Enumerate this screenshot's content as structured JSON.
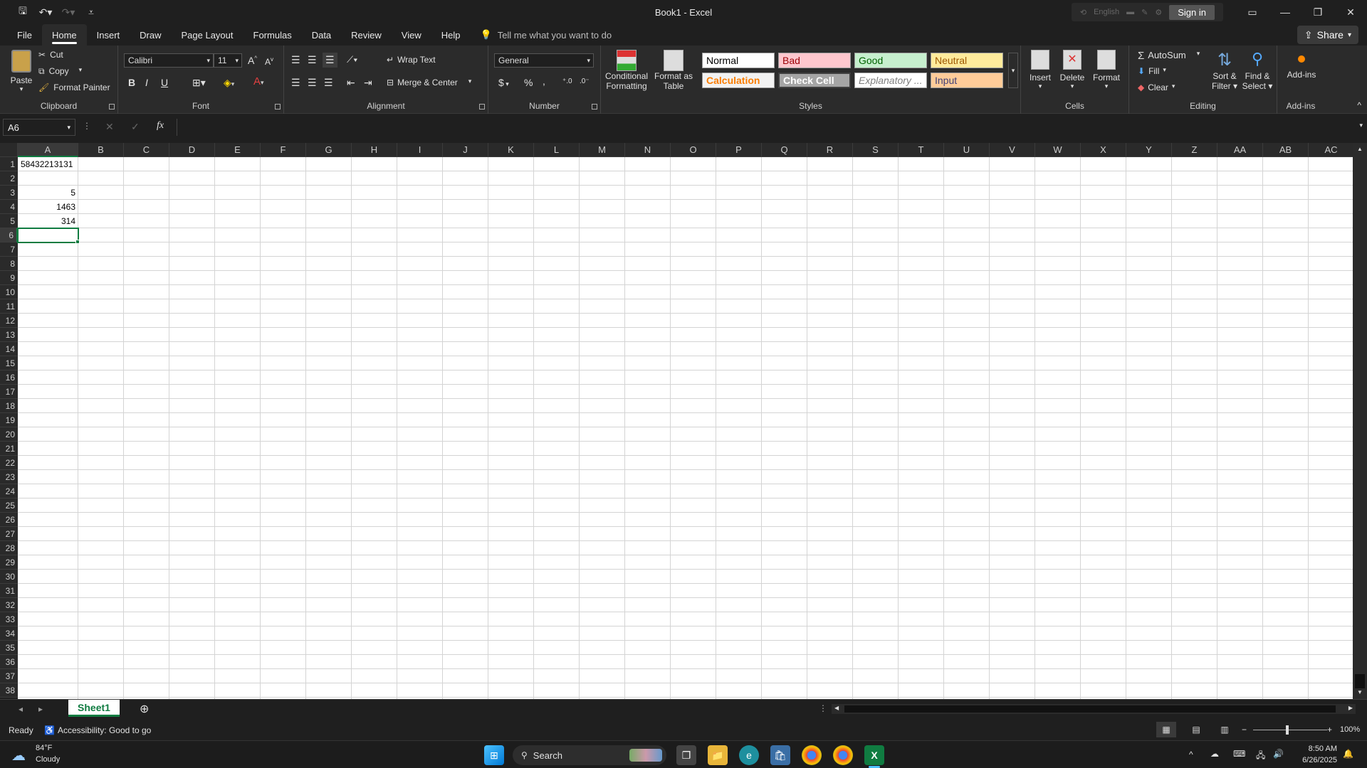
{
  "window": {
    "title": "Book1  -  Excel",
    "language": "English",
    "sign_in": "Sign in"
  },
  "menu": {
    "tabs": [
      "File",
      "Home",
      "Insert",
      "Draw",
      "Page Layout",
      "Formulas",
      "Data",
      "Review",
      "View",
      "Help"
    ],
    "tell_me": "Tell me what you want to do",
    "share": "Share"
  },
  "ribbon": {
    "clipboard": {
      "label": "Clipboard",
      "paste": "Paste",
      "cut": "Cut",
      "copy": "Copy",
      "format_painter": "Format Painter"
    },
    "font": {
      "label": "Font",
      "name": "Calibri",
      "size": "11",
      "bold": "B",
      "italic": "I",
      "underline": "U"
    },
    "alignment": {
      "label": "Alignment",
      "wrap": "Wrap Text",
      "merge": "Merge & Center"
    },
    "number": {
      "label": "Number",
      "format": "General",
      "currency": "$",
      "percent": "%",
      "comma": ","
    },
    "styles": {
      "label": "Styles",
      "conditional": "Conditional",
      "conditional2": "Formatting",
      "format_table": "Format as",
      "format_table2": "Table",
      "normal": "Normal",
      "bad": "Bad",
      "good": "Good",
      "neutral": "Neutral",
      "calculation": "Calculation",
      "check_cell": "Check Cell",
      "explanatory": "Explanatory ...",
      "input": "Input"
    },
    "cells": {
      "label": "Cells",
      "insert": "Insert",
      "delete": "Delete",
      "format": "Format"
    },
    "editing": {
      "label": "Editing",
      "autosum": "AutoSum",
      "fill": "Fill",
      "clear": "Clear",
      "sort": "Sort &",
      "sort2": "Filter",
      "find": "Find &",
      "find2": "Select"
    },
    "addins": {
      "label": "Add-ins",
      "addins": "Add-ins"
    }
  },
  "formula_bar": {
    "name_box": "A6",
    "fx": "fx"
  },
  "columns": [
    "A",
    "B",
    "C",
    "D",
    "E",
    "F",
    "G",
    "H",
    "I",
    "J",
    "K",
    "L",
    "M",
    "N",
    "O",
    "P",
    "Q",
    "R",
    "S",
    "T",
    "U",
    "V",
    "W",
    "X",
    "Y",
    "Z",
    "AA",
    "AB",
    "AC"
  ],
  "rows": [
    "1",
    "2",
    "3",
    "4",
    "5",
    "6",
    "7",
    "8",
    "9",
    "10",
    "11",
    "12",
    "13",
    "14",
    "15",
    "16",
    "17",
    "18",
    "19",
    "20",
    "21",
    "22",
    "23",
    "24",
    "25",
    "26",
    "27",
    "28",
    "29",
    "30",
    "31",
    "32",
    "33",
    "34",
    "35",
    "36",
    "37",
    "38"
  ],
  "cells": {
    "a1": "58432213131",
    "a3": "5",
    "a4": "1463",
    "a5": "314"
  },
  "sheet_tab": "Sheet1",
  "status": {
    "ready": "Ready",
    "accessibility": "Accessibility: Good to go",
    "zoom": "100%"
  },
  "taskbar": {
    "temp": "84°F",
    "weather": "Cloudy",
    "search": "Search",
    "time": "8:50 AM",
    "date": "6/26/2025"
  }
}
